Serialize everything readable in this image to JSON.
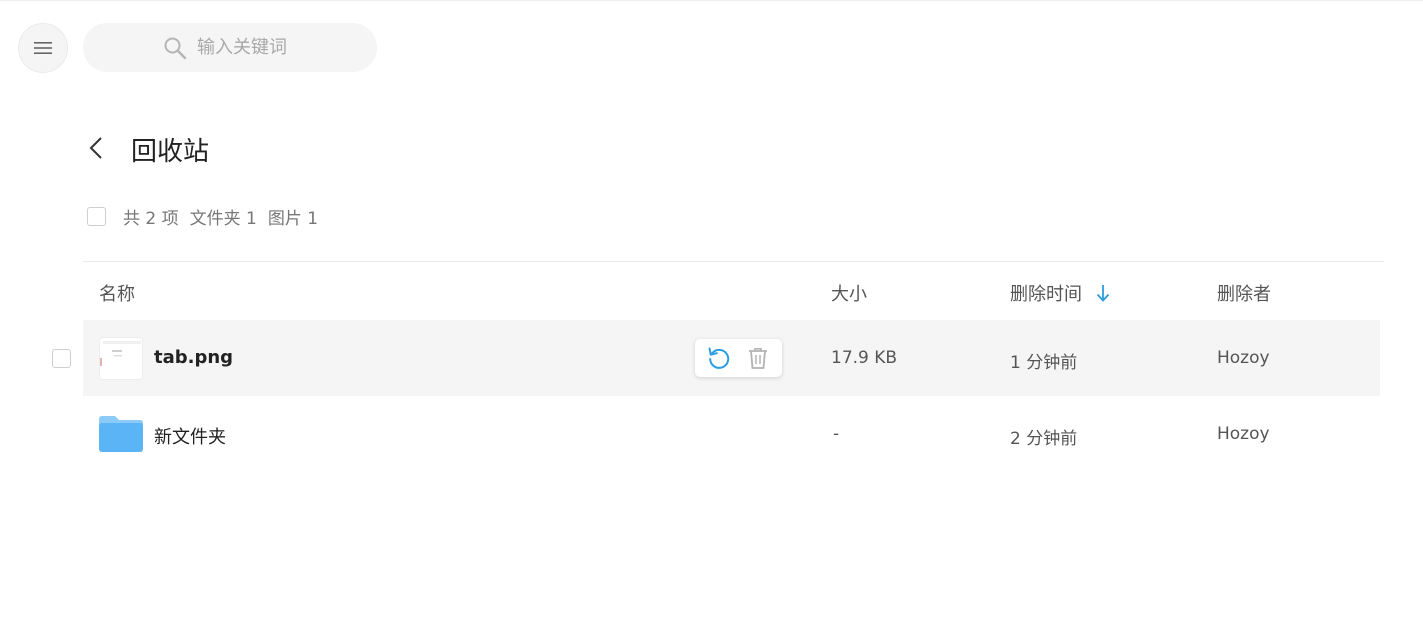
{
  "search": {
    "placeholder": "输入关键词"
  },
  "page": {
    "title": "回收站"
  },
  "summary": {
    "total": "共 2 项",
    "folders": "文件夹 1",
    "images": "图片 1"
  },
  "columns": {
    "name": "名称",
    "size": "大小",
    "deleted_time": "删除时间",
    "deleted_by": "删除者"
  },
  "rows": [
    {
      "name": "tab.png",
      "size": "17.9 KB",
      "deleted_time": "1 分钟前",
      "deleted_by": "Hozoy"
    },
    {
      "name": "新文件夹",
      "size": "-",
      "deleted_time": "2 分钟前",
      "deleted_by": "Hozoy"
    }
  ],
  "colors": {
    "accent": "#2c9de0",
    "folder": "#5ab4f5",
    "hover_row": "#f5f5f5"
  },
  "icons": [
    "menu-icon",
    "search-icon",
    "back-chevron-icon",
    "sort-down-arrow-icon",
    "restore-icon",
    "trash-icon",
    "folder-icon"
  ]
}
